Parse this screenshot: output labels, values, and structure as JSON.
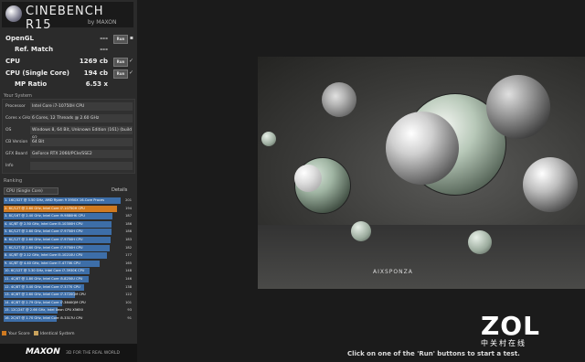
{
  "app": {
    "title": "CINEBENCH R15",
    "subtitle": "by MAXON"
  },
  "scores": [
    {
      "label": "OpenGL",
      "value": "---",
      "button": "Run",
      "check": "▪"
    },
    {
      "label": "Ref. Match",
      "value": "---",
      "button": "",
      "check": ""
    },
    {
      "label": "CPU",
      "value": "1269 cb",
      "button": "Run",
      "check": "✓"
    },
    {
      "label": "CPU (Single Core)",
      "value": "194 cb",
      "button": "Run",
      "check": "✓"
    },
    {
      "label": "MP Ratio",
      "value": "6.53 x",
      "button": "",
      "check": ""
    }
  ],
  "system": {
    "title": "Your System",
    "rows": [
      {
        "k": "Processor",
        "v": "Intel Core i7-10750H CPU"
      },
      {
        "k": "Cores x GHz",
        "v": "6 Cores, 12 Threads @ 2.60 GHz"
      },
      {
        "k": "OS",
        "v": "Windows 8, 64 Bit, Unknown Edition (161) (build 92"
      },
      {
        "k": "CB Version",
        "v": "64 Bit"
      },
      {
        "k": "GFX Board",
        "v": "GeForce RTX 2060/PCIe/SSE2"
      },
      {
        "k": "Info",
        "v": ""
      }
    ]
  },
  "ranking": {
    "title": "Ranking",
    "selector": "CPU (Single Core)",
    "details": "Details",
    "entries": [
      {
        "label": "1. 16C/32T @ 3.50 GHz, AMD Ryzen 9 3950X 16-Core Proces",
        "score": 201,
        "kind": "normal"
      },
      {
        "label": "2. 6C/12T @ 2.60 GHz, Intel Core i7-10750H CPU",
        "score": 194,
        "kind": "you"
      },
      {
        "label": "3. 8C/16T @ 2.40 GHz, Intel Core i9-9880HK CPU",
        "score": 187,
        "kind": "normal"
      },
      {
        "label": "4. 4C/8T @ 2.50 GHz, Intel Core i5-10300H CPU",
        "score": 186,
        "kind": "normal"
      },
      {
        "label": "5. 6C/12T @ 2.60 GHz, Intel Core i7-9750H CPU",
        "score": 186,
        "kind": "normal"
      },
      {
        "label": "6. 6C/12T @ 2.60 GHz, Intel Core i7-9750H CPU",
        "score": 183,
        "kind": "normal"
      },
      {
        "label": "7. 6C/12T @ 2.60 GHz, Intel Core i7-9750H CPU",
        "score": 182,
        "kind": "normal"
      },
      {
        "label": "8. 4C/8T @ 2.12 GHz, Intel Core i5-10210U CPU",
        "score": 177,
        "kind": "normal"
      },
      {
        "label": "9. 4C/8T @ 4.40 GHz, Intel Core i7-4770K CPU",
        "score": 165,
        "kind": "normal"
      },
      {
        "label": "10. 6C/12T @ 3.30 GHz, Intel Core i7-3930K CPU",
        "score": 148,
        "kind": "normal"
      },
      {
        "label": "11. 4C/8T @ 1.80 GHz, Intel Core i5-8250U CPU",
        "score": 146,
        "kind": "normal"
      },
      {
        "label": "12. 4C/8T @ 3.40 GHz, Intel Core i7-3770 CPU",
        "score": 138,
        "kind": "normal"
      },
      {
        "label": "13. 4C/8T @ 2.60 GHz, Intel Core i7-3720QM CPU",
        "score": 122,
        "kind": "normal"
      },
      {
        "label": "14. 4C/8T @ 2.79 GHz, Intel Core i7-3840QM CPU",
        "score": 101,
        "kind": "normal"
      },
      {
        "label": "15. 12C/24T @ 2.66 GHz, Intel Xeon CPU X5650",
        "score": 93,
        "kind": "normal"
      },
      {
        "label": "16. 2C/4T @ 1.70 GHz, Intel Core i5-3317U CPU",
        "score": 91,
        "kind": "normal"
      }
    ],
    "legend_you": "Your Score",
    "legend_identical": "Identical System"
  },
  "colors": {
    "bar": "#3d6ea8",
    "you": "#d07a20",
    "identical": "#c9a25c"
  },
  "footer": {
    "brand": "MAXON",
    "tagline": "3D FOR THE REAL WORLD"
  },
  "render": {
    "watermark": "AIXSPONZA"
  },
  "overlay": {
    "logo": "ZOL",
    "logo_sub": "中关村在线"
  },
  "status": {
    "hint": "Click on one of the 'Run' buttons to start a test."
  }
}
